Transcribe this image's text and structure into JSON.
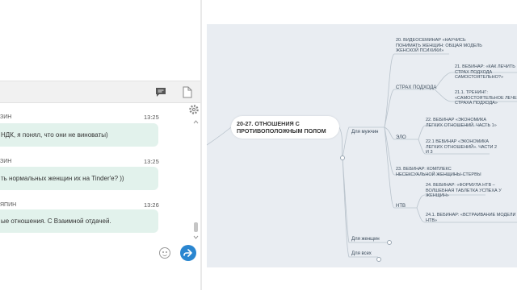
{
  "chat": {
    "messages": [
      {
        "name": "ЗИН",
        "time": "13:25",
        "text": "НДК, я понял, что они не виноваты)"
      },
      {
        "name": "ЗИН",
        "time": "13:25",
        "text": "ть нормальных женщин их на Tinder'е? ))"
      },
      {
        "name": "ЯПИН",
        "time": "13:26",
        "text": "ые отношения. С Взаимной отдачей."
      }
    ],
    "icons": {
      "chat": "chat-bubble-icon",
      "doc": "document-icon",
      "settings": "gear-icon",
      "emoji": "emoji-icon",
      "send": "send-icon"
    }
  },
  "mindmap": {
    "central": "20-27. ОТНОШЕНИЯ С\nПРОТИВОПОЛОЖНЫМ ПОЛОМ",
    "branches": {
      "men": "Для мужчин",
      "women": "Для женщин",
      "all": "Для всех"
    },
    "nodes": {
      "n20": "20. ВИДЕОСЕМИНАР «НАУЧИСЬ\nПОНИМАТЬ ЖЕНЩИН: ОБЩАЯ МОДЕЛЬ\nЖЕНСКОЙ ПСИХИКИ»",
      "fear": "СТРАХ ПОДХОДА",
      "n21": "21. ВЕБИНАР: «КАК ЛЕЧИТЬ\nСТРАХ ПОДХОДА\nСАМОСТОЯТЕЛЬНО?»",
      "n211": "21.1. ТРЕНИНГ:\n«САМОСТОЯТЕЛЬНОЕ ЛЕЧЕ\nСТРАХА ПОДХОДА»",
      "elo": "ЭЛО",
      "n22": "22. ВЕБИНАР «ЭКОНОМИКА\nЛЕГКИХ ОТНОШЕНИЙ. ЧАСТЬ 1»",
      "n221": "22.1 ВЕБИНАР «ЭКОНОМИКА\nЛЕГКИХ ОТНОШЕНИЙ». ЧАСТИ 2\nИ 3",
      "n23": "23. ВЕБИНАР: КОМПЛЕКС\nНЕСЕКСУАЛЬНОЙ ЖЕНЩИНЫ-СТЕРВЫ",
      "nts": "НТВ",
      "n24": "24. ВЕБИНАР: «ФОРМУЛА НТВ –\nВОЛШЕБНАЯ ТАБЛЕТКА УСПЕХА У\nЖЕНЩИН»",
      "n241": "24.1. ВЕБИНАР: «ВСТРАИВАНИЕ МОДЕЛИ\nНТВ»"
    },
    "colors": {
      "background": "#e9edf2",
      "lines": "#b9c3cc"
    }
  }
}
